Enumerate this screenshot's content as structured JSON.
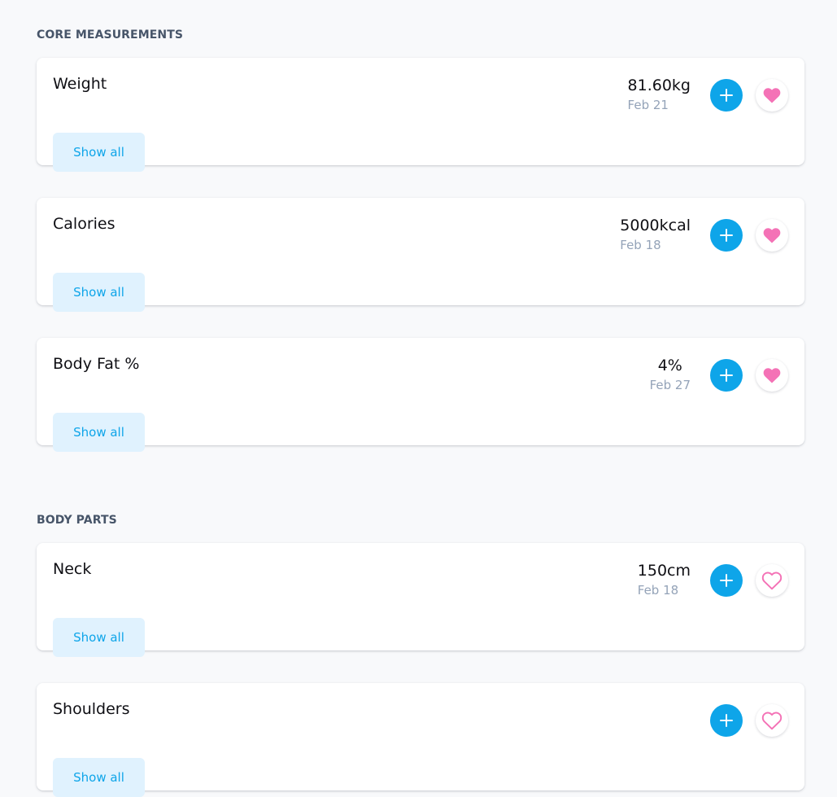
{
  "colors": {
    "background": "#f8f9fb",
    "accent": "#0ea5e9",
    "accent_light": "#e0f2fe",
    "favorite": "#f472b6",
    "muted_text": "#94a3b8",
    "section_title": "#475569"
  },
  "sections": [
    {
      "title": "CORE MEASUREMENTS",
      "items": [
        {
          "name": "Weight",
          "value": "81.60kg",
          "date": "Feb 21",
          "favorite": true,
          "show_all_label": "Show all"
        },
        {
          "name": "Calories",
          "value": "5000kcal",
          "date": "Feb 18",
          "favorite": true,
          "show_all_label": "Show all"
        },
        {
          "name": "Body Fat %",
          "value": "4%",
          "date": "Feb 27",
          "favorite": true,
          "show_all_label": "Show all"
        }
      ]
    },
    {
      "title": "BODY PARTS",
      "items": [
        {
          "name": "Neck",
          "value": "150cm",
          "date": "Feb 18",
          "favorite": false,
          "show_all_label": "Show all"
        },
        {
          "name": "Shoulders",
          "value": "",
          "date": "",
          "favorite": false,
          "show_all_label": "Show all"
        }
      ]
    }
  ],
  "icons": {
    "add": "plus-icon",
    "favorite_on": "heart-filled-icon",
    "favorite_off": "heart-outline-icon"
  }
}
